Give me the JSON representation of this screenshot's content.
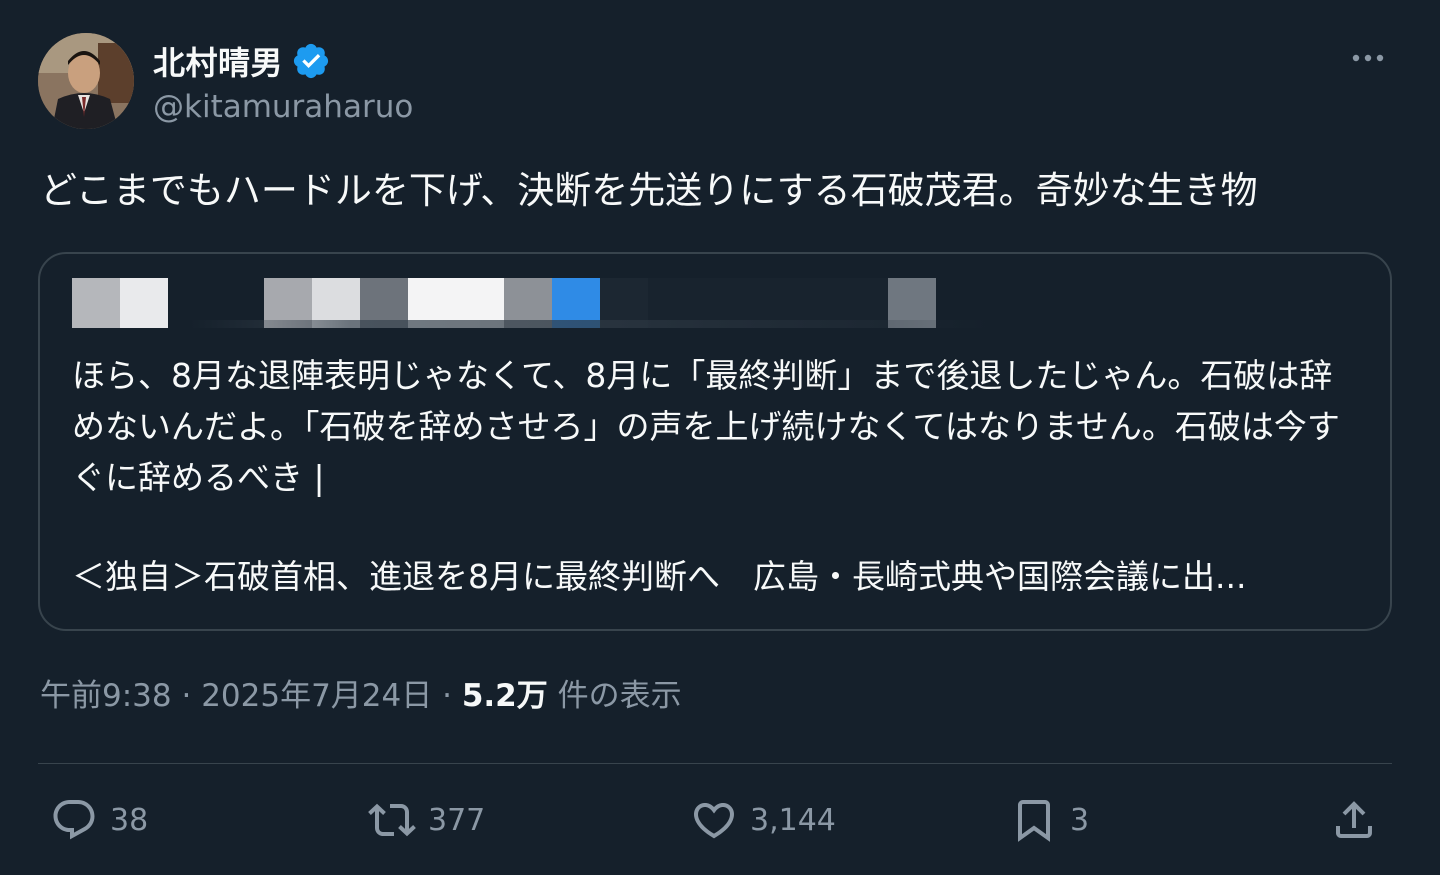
{
  "author": {
    "display_name": "北村晴男",
    "handle": "@kitamuraharuo",
    "verified": true,
    "verified_color": "#1d9bf0"
  },
  "tweet": {
    "text": "どこまでもハードルを下げ、決断を先送りにする石破茂君。奇妙な生き物"
  },
  "quote": {
    "author_redacted": true,
    "text": "ほら、8月な退陣表明じゃなくて、8月に「最終判断」まで後退したじゃん。石破は辞めないんだよ。「石破を辞めさせろ」の声を上げ続けなくてはなりません。石破は今すぐに辞めるべき |",
    "link_title": "＜独自＞石破首相、進退を8月に最終判断へ　広島・長崎式典や国際会議に出..."
  },
  "meta": {
    "time": "午前9:38",
    "separator": " · ",
    "date": "2025年7月24日",
    "views_count": "5.2万",
    "views_label": " 件の表示"
  },
  "actions": {
    "replies": "38",
    "reposts": "377",
    "likes": "3,144",
    "bookmarks": "3"
  },
  "icons": {
    "more": "more-icon",
    "reply": "reply-icon",
    "repost": "repost-icon",
    "like": "heart-icon",
    "bookmark": "bookmark-icon",
    "share": "share-icon"
  },
  "colors": {
    "background": "#15202b",
    "text": "#f7f9f9",
    "secondary": "#8b98a5",
    "border": "#38444d"
  }
}
